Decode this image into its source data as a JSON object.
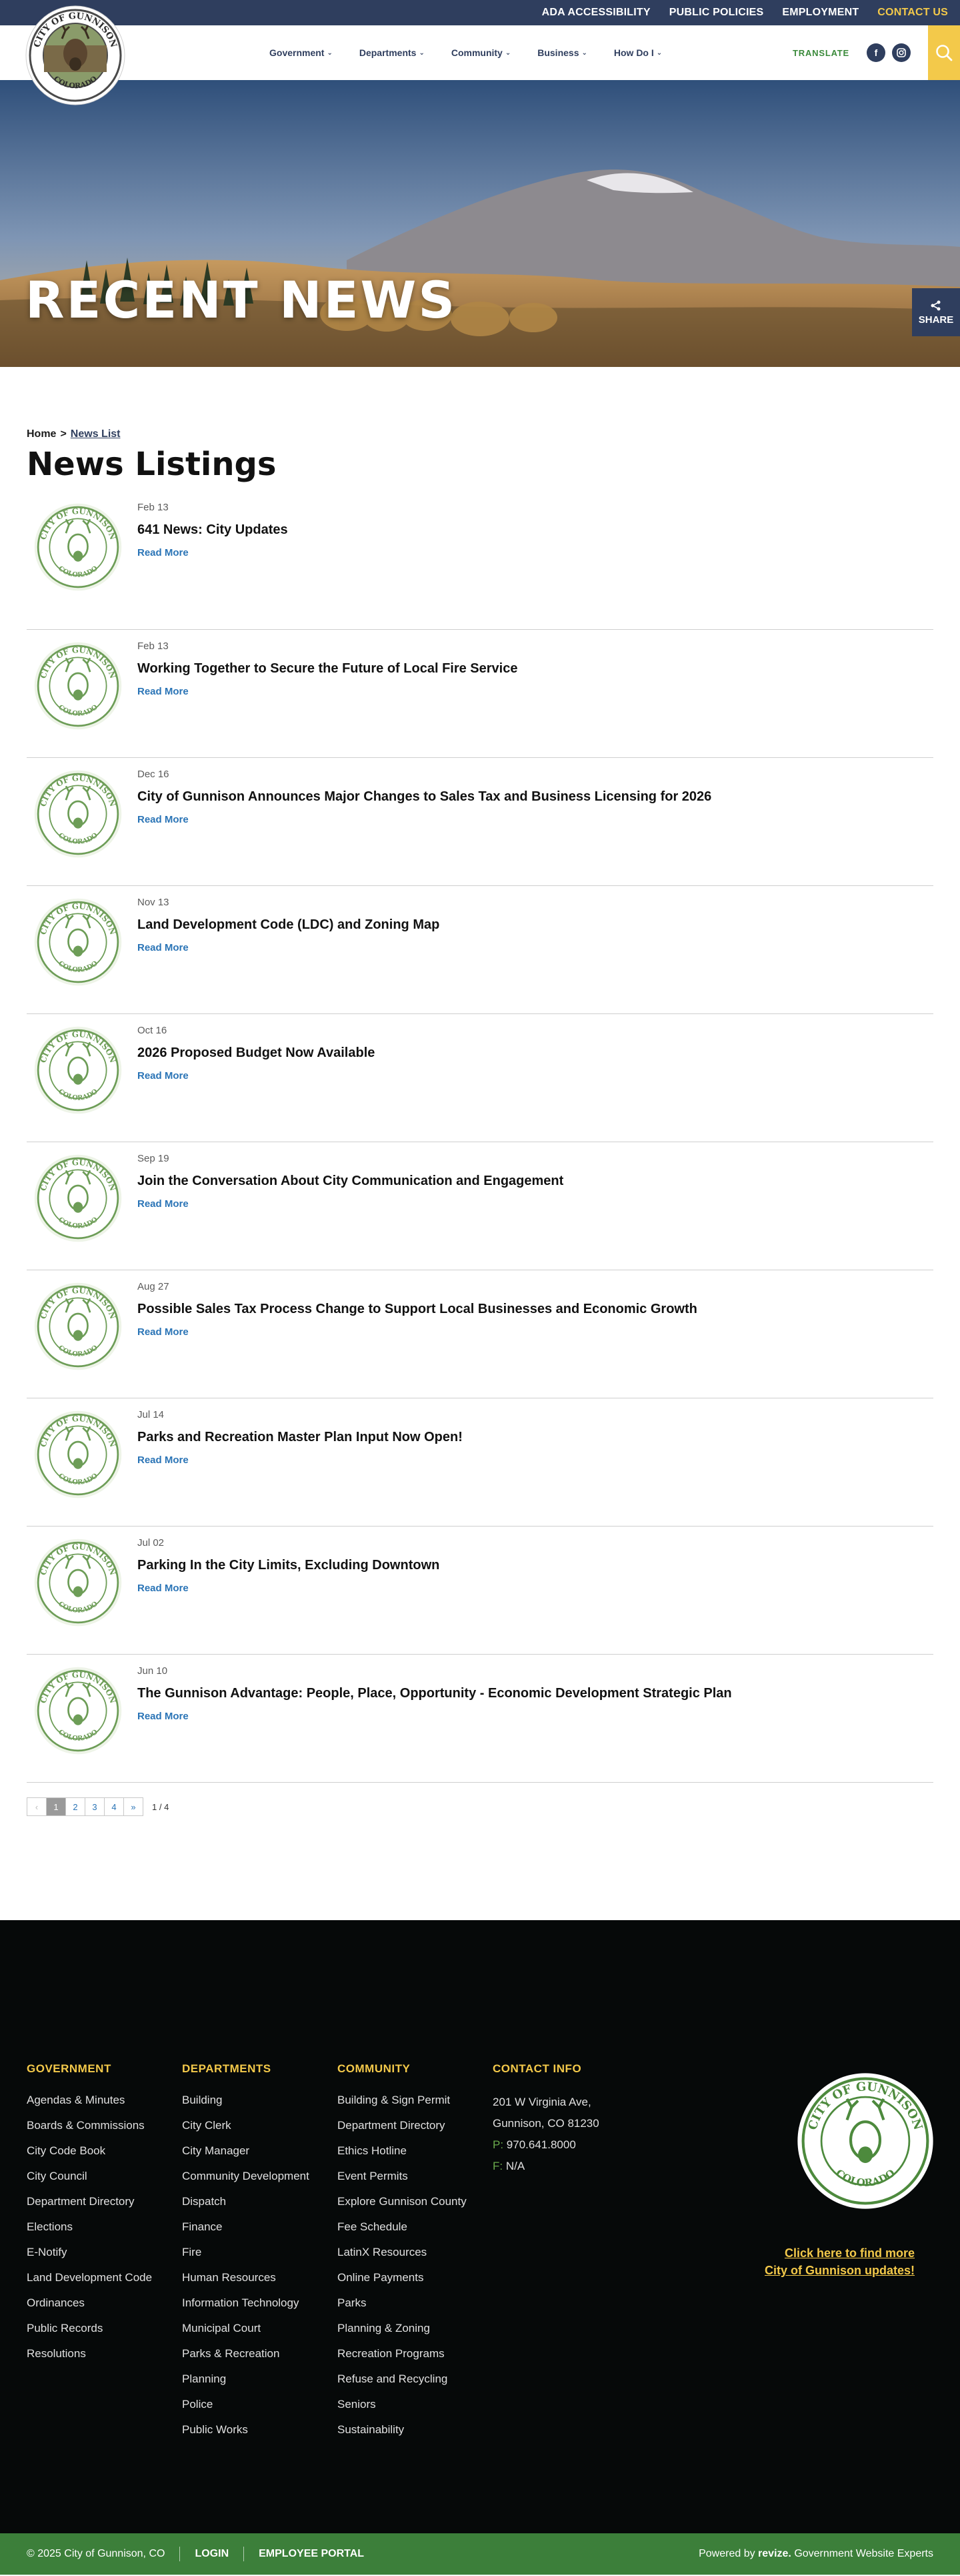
{
  "topbar": {
    "links": [
      "ADA ACCESSIBILITY",
      "PUBLIC POLICIES",
      "EMPLOYMENT",
      "CONTACT US"
    ]
  },
  "logo": {
    "seal_text_top": "CITY OF GUNNISON",
    "seal_text_bottom": "COLORADO"
  },
  "nav": {
    "items": [
      "Government",
      "Departments",
      "Community",
      "Business",
      "How Do I"
    ],
    "translate": "TRANSLATE",
    "social": [
      "f",
      "ig"
    ]
  },
  "hero": {
    "title": "RECENT NEWS",
    "share_label": "SHARE"
  },
  "breadcrumb": {
    "home": "Home",
    "separator": ">",
    "current": "News List"
  },
  "page_title": "News Listings",
  "news": [
    {
      "date": "Feb 13",
      "title": "641 News: City Updates",
      "link": "Read More"
    },
    {
      "date": "Feb 13",
      "title": "Working Together to Secure the Future of Local Fire Service",
      "link": "Read More"
    },
    {
      "date": "Dec 16",
      "title": "City of Gunnison Announces Major Changes to Sales Tax and Business Licensing for 2026",
      "link": "Read More"
    },
    {
      "date": "Nov 13",
      "title": "Land Development Code (LDC) and Zoning Map",
      "link": "Read More"
    },
    {
      "date": "Oct 16",
      "title": "2026 Proposed Budget Now Available",
      "link": "Read More"
    },
    {
      "date": "Sep 19",
      "title": "Join the Conversation About City Communication and Engagement",
      "link": "Read More"
    },
    {
      "date": "Aug 27",
      "title": "Possible Sales Tax Process Change to Support Local Businesses and Economic Growth",
      "link": "Read More"
    },
    {
      "date": "Jul 14",
      "title": "Parks and Recreation Master Plan Input Now Open!",
      "link": "Read More"
    },
    {
      "date": "Jul 02",
      "title": "Parking In the City Limits, Excluding Downtown",
      "link": "Read More"
    },
    {
      "date": "Jun 10",
      "title": "The Gunnison Advantage: People, Place, Opportunity - Economic Development Strategic Plan",
      "link": "Read More"
    }
  ],
  "pagination": {
    "prev": "‹",
    "pages": [
      "1",
      "2",
      "3",
      "4"
    ],
    "next": "»",
    "current": "1",
    "count": "1 / 4"
  },
  "footer": {
    "government": {
      "heading": "GOVERNMENT",
      "items": [
        "Agendas & Minutes",
        "Boards & Commissions",
        "City Code Book",
        "City Council",
        "Department Directory",
        "Elections",
        "E-Notify",
        "Land Development Code",
        "Ordinances",
        "Public Records",
        "Resolutions"
      ]
    },
    "departments": {
      "heading": "DEPARTMENTS",
      "items": [
        "Building",
        "City Clerk",
        "City Manager",
        "Community Development",
        "Dispatch",
        "Finance",
        "Fire",
        "Human Resources",
        "Information Technology",
        "Municipal Court",
        "Parks & Recreation",
        "Planning",
        "Police",
        "Public Works"
      ]
    },
    "community": {
      "heading": "COMMUNITY",
      "items": [
        "Building & Sign Permit",
        "Department Directory",
        "Ethics Hotline",
        "Event Permits",
        "Explore Gunnison County",
        "Fee Schedule",
        "LatinX Resources",
        "Online Payments",
        "Parks",
        "Planning & Zoning",
        "Recreation Programs",
        "Refuse and Recycling",
        "Seniors",
        "Sustainability"
      ]
    },
    "contact": {
      "heading": "CONTACT INFO",
      "address1": "201 W Virginia Ave,",
      "address2": "Gunnison, CO 81230",
      "phone_label": "P:",
      "phone": "970.641.8000",
      "fax_label": "F:",
      "fax": "N/A"
    },
    "updates_line1": "Click here to find more",
    "updates_line2": "City of Gunnison updates!",
    "bottom": {
      "copyright": "© 2025 City of Gunnison, CO",
      "login": "LOGIN",
      "employee_portal": "EMPLOYEE PORTAL",
      "powered_prefix": "Powered by",
      "powered_brand": "revize.",
      "powered_suffix": "Government Website Experts"
    }
  },
  "colors": {
    "navy": "#2f3e5e",
    "gold": "#f3c94a",
    "link_blue": "#2a74b6",
    "footer_green": "#3c7f3a",
    "footer_bg": "#060909"
  }
}
